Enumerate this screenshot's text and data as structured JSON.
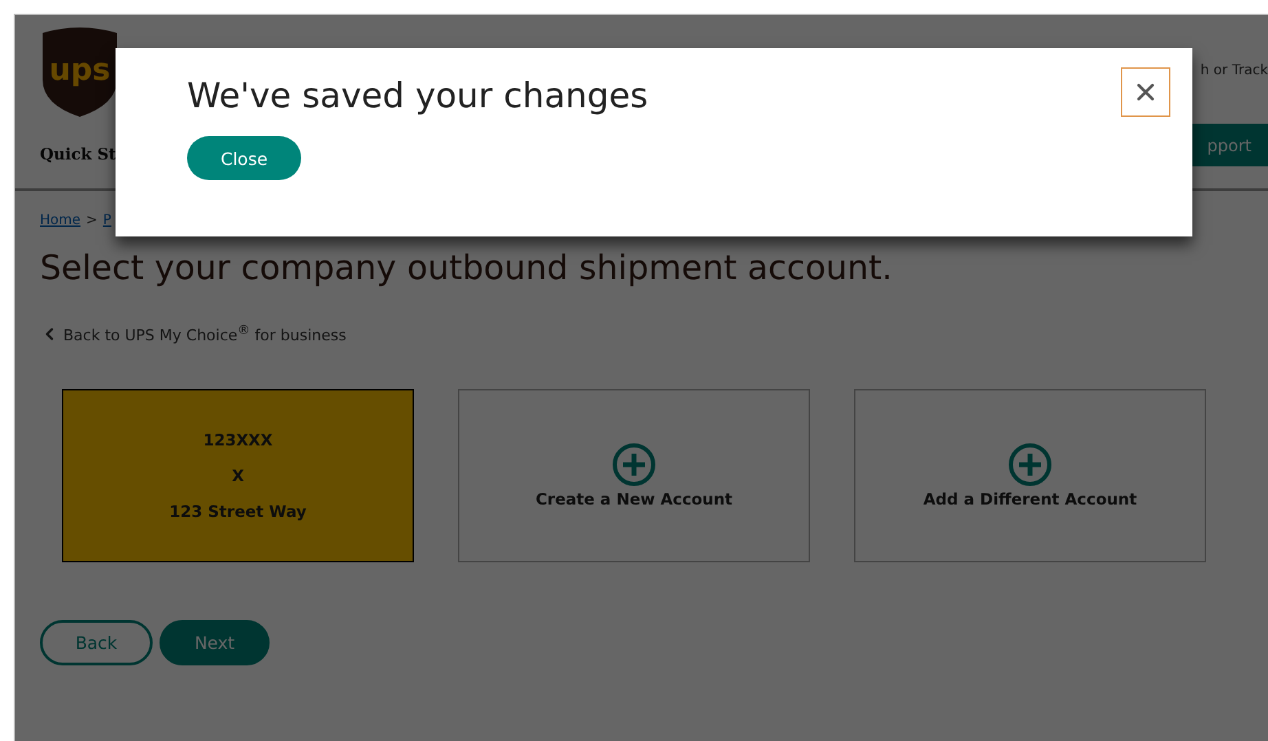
{
  "header": {
    "logo_text": "ups",
    "nav_label": "Quick St",
    "utility_link": "h or Track",
    "support_button": "pport"
  },
  "breadcrumb": {
    "items": [
      "Home",
      "P"
    ],
    "separator": ">"
  },
  "heading": "Select your company outbound shipment account.",
  "back_link": "Back to UPS My Choice$^{®}$ for business",
  "accounts": [
    {
      "kind": "account",
      "selected": true,
      "lines": [
        "123XXX",
        "X",
        "123 Street Way"
      ]
    },
    {
      "kind": "add",
      "selected": false,
      "label": "Create a New Account"
    },
    {
      "kind": "add",
      "selected": false,
      "label": "Add a Different Account"
    }
  ],
  "actions": [
    {
      "kind": "secondary",
      "label": "Back"
    },
    {
      "kind": "primary",
      "label": "Next"
    }
  ],
  "dialog": {
    "title": "We've saved your changes",
    "close_button": "Close"
  }
}
